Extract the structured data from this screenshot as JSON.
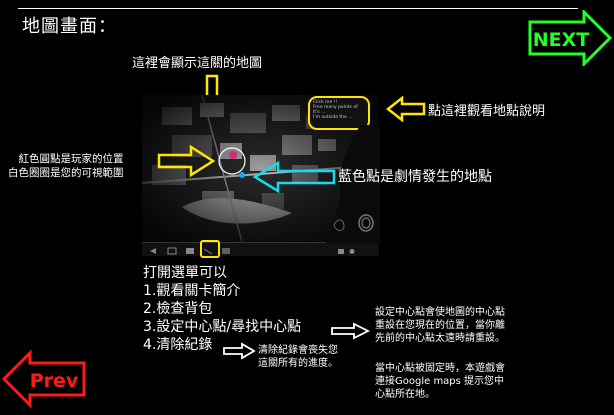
{
  "page": {
    "title": "地圖畫面：",
    "map_caption": "這裡會顯示這關的地圖",
    "tap_hint": "點這裡觀看地點說明",
    "red_dot_line1": "紅色圓點是玩家的位置",
    "red_dot_line2": "白色圈圈是您的可視範圍",
    "blue_dot": "藍色點是劇情發生的地點",
    "popup_text": [
      "Click me !!",
      "Free many points of",
      "It's ...",
      "I'm outside the ..."
    ]
  },
  "menu": {
    "heading": "打開選單可以",
    "items": [
      "1.觀看關卡簡介",
      "2.檢查背包",
      "3.設定中心點/尋找中心點",
      "4.清除紀錄"
    ]
  },
  "notes": {
    "clear": [
      "清除紀錄會喪失您",
      "這關所有的進度。"
    ],
    "center": [
      "設定中心點會使地圖的中心點",
      "重設在您現在的位置，當你離",
      "先前的中心點太遠時請重設。"
    ],
    "fixed": [
      "當中心點被固定時，本遊戲會",
      "連接Google maps 提示您中",
      "心點所在地。"
    ]
  },
  "nav": {
    "next": "NEXT",
    "prev": "Prev"
  },
  "colors": {
    "yellow": "#ffe600",
    "cyan": "#14dcf0",
    "green": "#22ff22",
    "red": "#ff1a1a"
  }
}
